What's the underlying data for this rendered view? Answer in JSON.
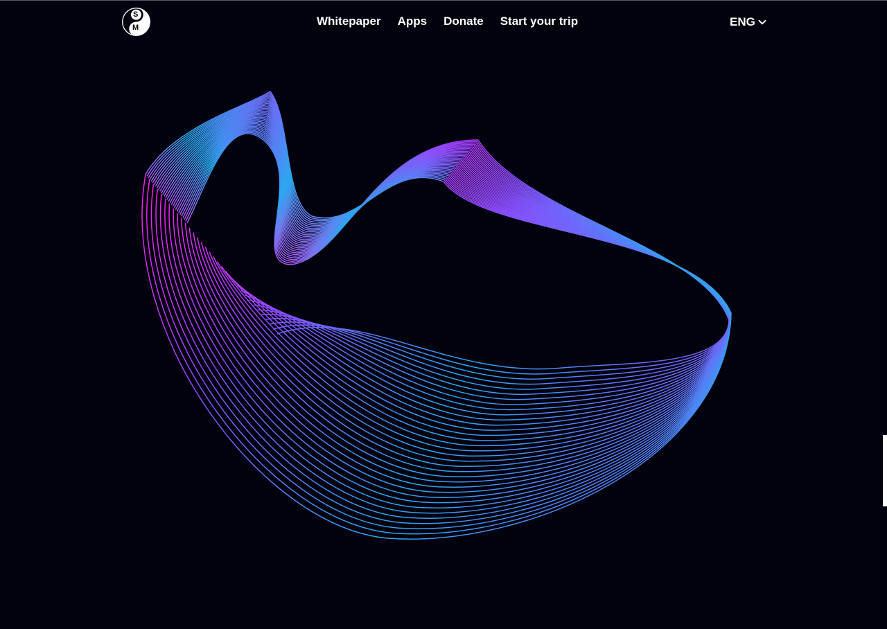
{
  "header": {
    "logo": {
      "text_top": "S",
      "text_bottom": "M",
      "icon": "yin-yang-logo-icon"
    },
    "nav": [
      {
        "label": "Whitepaper"
      },
      {
        "label": "Apps"
      },
      {
        "label": "Donate"
      },
      {
        "label": "Start your trip"
      }
    ],
    "language": {
      "selected": "ENG",
      "icon": "chevron-down-icon"
    }
  },
  "hero": {
    "artwork": "wireframe-wave-ribbon",
    "colors": {
      "background": "#02020f",
      "magenta": "#ff1cf0",
      "violet": "#8a4dff",
      "cyan": "#2aa8f0"
    }
  }
}
